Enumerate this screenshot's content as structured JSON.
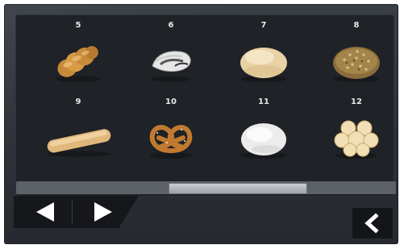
{
  "programs": [
    {
      "number": "5",
      "icon": "braided-bread-icon"
    },
    {
      "number": "6",
      "icon": "croissant-icon"
    },
    {
      "number": "7",
      "icon": "white-roll-icon"
    },
    {
      "number": "8",
      "icon": "seeded-bread-icon"
    },
    {
      "number": "9",
      "icon": "baguette-icon"
    },
    {
      "number": "10",
      "icon": "pretzel-icon"
    },
    {
      "number": "11",
      "icon": "flour-roll-icon"
    },
    {
      "number": "12",
      "icon": "pull-apart-rolls-icon"
    }
  ],
  "scrollbar": {
    "position_fraction": 0.36,
    "visible_fraction": 0.36
  },
  "nav": {
    "prev_icon": "arrow-left-icon",
    "next_icon": "arrow-right-icon"
  },
  "back": {
    "icon": "chevron-left-icon"
  },
  "colors": {
    "background": "#2c3036",
    "panel": "#1f2226",
    "text": "#e8e8e8"
  }
}
